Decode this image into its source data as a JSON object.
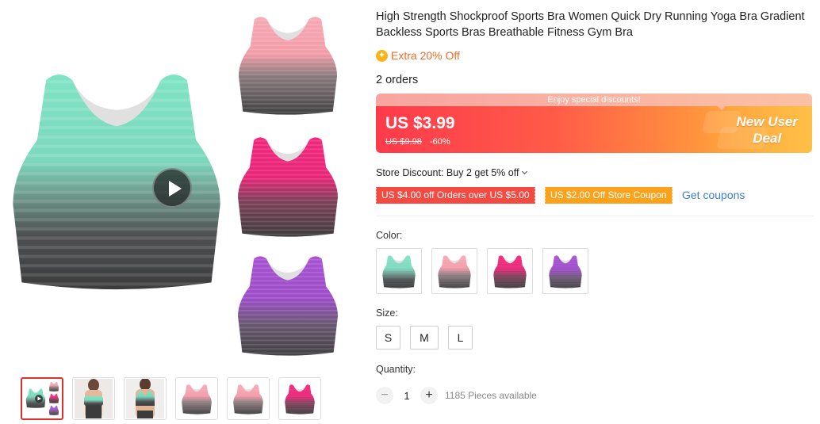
{
  "product": {
    "title": "High Strength Shockproof Sports Bra Women Quick Dry Running Yoga Bra Gradient Backless Sports Bras Breathable Fitness Gym Bra",
    "extra_discount": "Extra 20% Off",
    "orders": "2 orders"
  },
  "banner": {
    "top_text": "Enjoy special discounts!",
    "price": "US $3.99",
    "original_price": "US $9.98",
    "discount_percent": "-60%",
    "deal_line1": "New User",
    "deal_line2": "Deal"
  },
  "store": {
    "discount_text": "Store Discount: Buy 2 get 5% off",
    "coupons": [
      "US $4.00 off Orders over US $5.00",
      "US $2.00 Off Store Coupon"
    ],
    "get_coupons": "Get coupons"
  },
  "options": {
    "color_label": "Color:",
    "colors": [
      "mint-gray",
      "pink-gray",
      "magenta-gray",
      "purple-gray"
    ],
    "size_label": "Size:",
    "sizes": [
      "S",
      "M",
      "L"
    ]
  },
  "quantity": {
    "label": "Quantity:",
    "minus": "−",
    "value": "1",
    "plus": "+",
    "available": "1185 Pieces available"
  },
  "icons": {
    "extra_icon": "coin-icon",
    "play": "play-icon",
    "dropdown": "chevron-down-icon"
  },
  "colors": {
    "mint": "#7fe3c4",
    "pink": "#f7a9b4",
    "magenta": "#f1267a",
    "purple": "#a64fd0",
    "price_red": "#fe3a4b",
    "price_orange": "#ffb53d",
    "coupon_red": "#f34a42",
    "coupon_orange": "#faa21b",
    "link_blue": "#3d7fcf"
  }
}
